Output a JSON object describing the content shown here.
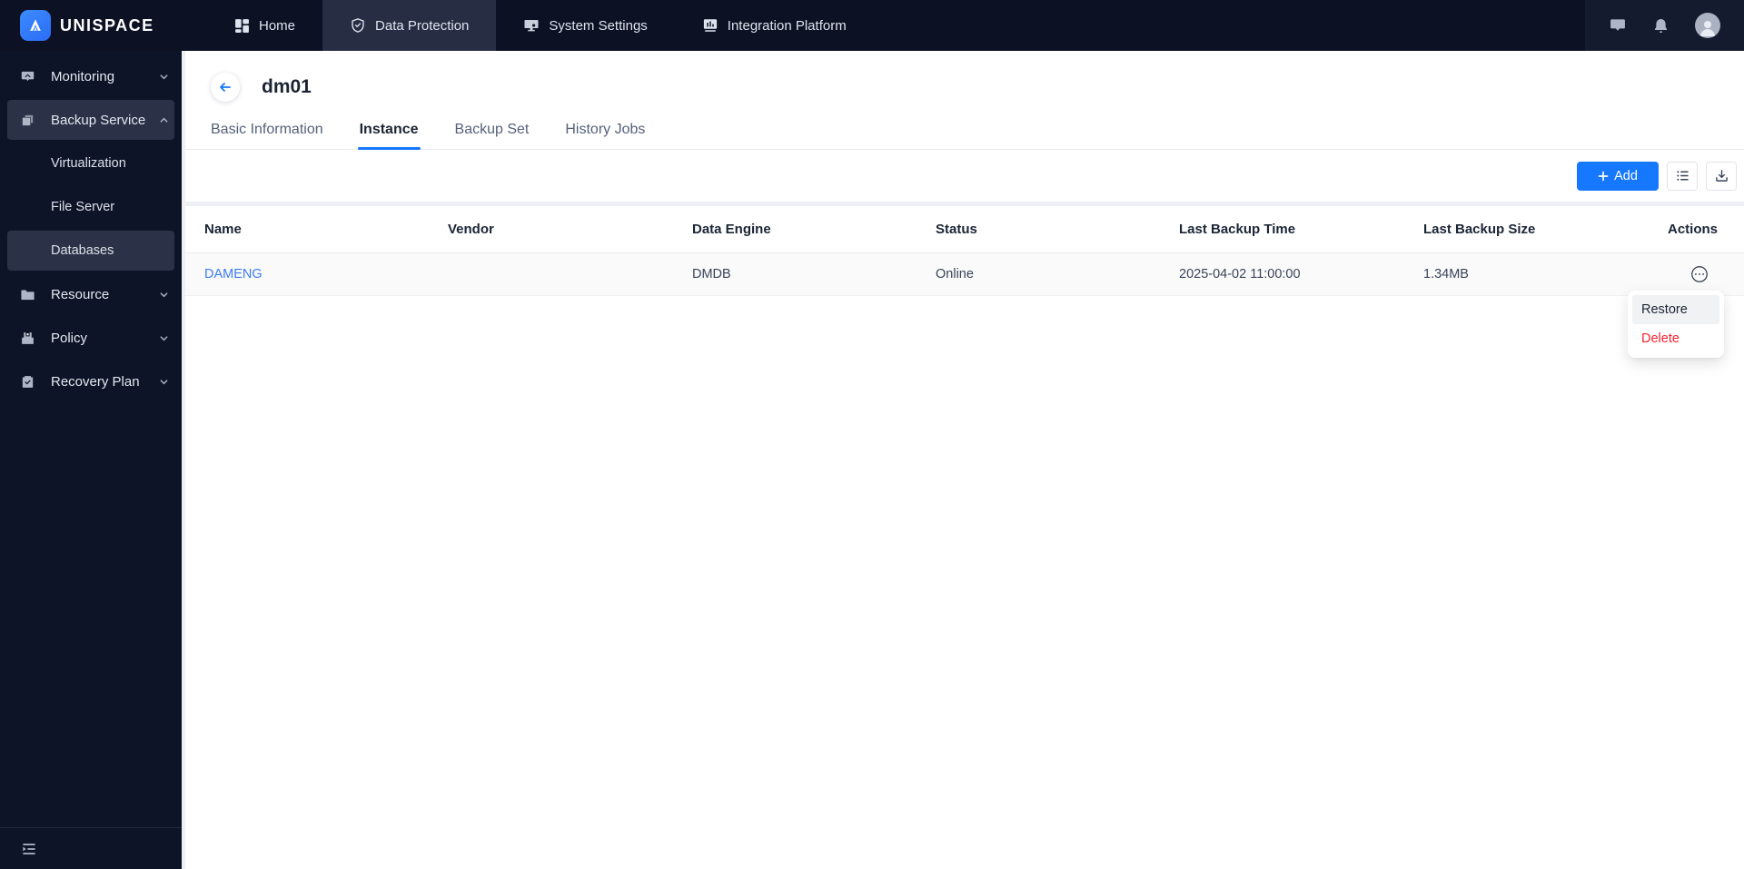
{
  "colors": {
    "accent": "#1677ff",
    "link": "#3b7cf7",
    "danger": "#f5222d",
    "navbar-bg": "#0c1124",
    "navbar-right-bg": "#151b2f",
    "navbar-active-bg": "#272e44",
    "sidebar-bg": "#0e1428",
    "sidebar-active-bg": "#2b3247",
    "gutter": "#eef0f3"
  },
  "brand": {
    "name": "UNISPACE",
    "logo_icon": "mountain-a-logo"
  },
  "topnav": {
    "items": [
      {
        "label": "Home",
        "icon": "dashboard-grid-icon",
        "active": false
      },
      {
        "label": "Data Protection",
        "icon": "shield-check-icon",
        "active": true
      },
      {
        "label": "System Settings",
        "icon": "monitor-icon",
        "active": false
      },
      {
        "label": "Integration Platform",
        "icon": "bar-chart-box-icon",
        "active": false
      }
    ],
    "right_icons": [
      "message-icon",
      "bell-icon",
      "user-avatar"
    ]
  },
  "sidebar": {
    "items": [
      {
        "label": "Monitoring",
        "icon": "bubble-chevron-icon",
        "expanded": false
      },
      {
        "label": "Backup Service",
        "icon": "copy-layers-icon",
        "expanded": true,
        "selected": true
      },
      {
        "label": "Virtualization",
        "sub": true
      },
      {
        "label": "File Server",
        "sub": true
      },
      {
        "label": "Databases",
        "sub": true,
        "selected": true
      },
      {
        "label": "Resource",
        "icon": "folder-icon",
        "expanded": false
      },
      {
        "label": "Policy",
        "icon": "archive-save-icon",
        "expanded": false
      },
      {
        "label": "Recovery Plan",
        "icon": "clipboard-check-icon",
        "expanded": false
      }
    ],
    "footer_icon": "menu-fold-icon"
  },
  "page": {
    "title": "dm01",
    "tabs": [
      {
        "label": "Basic Information",
        "active": false
      },
      {
        "label": "Instance",
        "active": true
      },
      {
        "label": "Backup Set",
        "active": false
      },
      {
        "label": "History Jobs",
        "active": false
      }
    ],
    "toolbar": {
      "add_label": "Add",
      "icon_buttons": [
        "unordered-list-icon",
        "download-icon"
      ]
    }
  },
  "table": {
    "columns": [
      "Name",
      "Vendor",
      "Data Engine",
      "Status",
      "Last Backup Time",
      "Last Backup Size",
      "Actions"
    ],
    "rows": [
      {
        "name": "DAMENG",
        "vendor": "",
        "data_engine": "DMDB",
        "status": "Online",
        "last_backup_time": "2025-04-02 11:00:00",
        "last_backup_size": "1.34MB",
        "actions_icon": "ellipsis-circle-icon"
      }
    ]
  },
  "context_menu": {
    "items": [
      {
        "label": "Restore",
        "highlighted": true,
        "danger": false
      },
      {
        "label": "Delete",
        "highlighted": false,
        "danger": true
      }
    ]
  }
}
